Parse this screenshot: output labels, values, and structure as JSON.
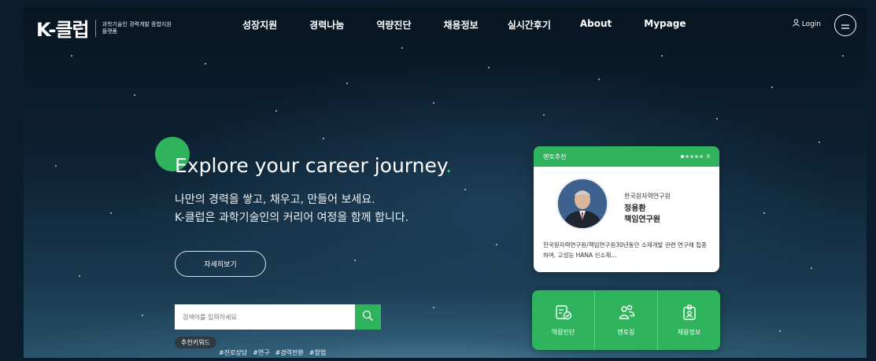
{
  "header": {
    "logo_mark": "K-클럽",
    "logo_tagline": "과학기술인 경력개발 종합지원 플랫폼",
    "nav": [
      "성장지원",
      "경력나눔",
      "역량진단",
      "채용정보",
      "실시간후기",
      "About",
      "Mypage"
    ],
    "login_label": "Login"
  },
  "hero": {
    "title": "Explore your career journey",
    "title_dot": ".",
    "subtitle_line1": "나만의 경력을 쌓고, 채우고, 만들어 보세요.",
    "subtitle_line2": "K-클럽은 과학기술인의 커리어 여정을 함께 합니다.",
    "detail_button": "자세히보기"
  },
  "search": {
    "placeholder": "검색어를 입력하세요",
    "keyword_badge": "추천키워드",
    "keywords": [
      "#진로상담",
      "#연구",
      "#경력전환",
      "#창업"
    ]
  },
  "mentor_card": {
    "label": "멘토추천",
    "pager_pause": "II",
    "org": "한국원자력연구원",
    "name": "정용환",
    "position": "책임연구원",
    "description": "한국원자력연구원/책임연구원30년동안 소재개발 관련 연구에 집중하여, 고성능 HANA 신소재..."
  },
  "quick_menu": [
    {
      "label": "역량진단",
      "icon": "diagnosis-icon"
    },
    {
      "label": "멘토링",
      "icon": "mentoring-icon"
    },
    {
      "label": "채용정보",
      "icon": "job-badge-icon"
    }
  ],
  "colors": {
    "accent": "#2fb35c",
    "background": "#0d2234"
  }
}
